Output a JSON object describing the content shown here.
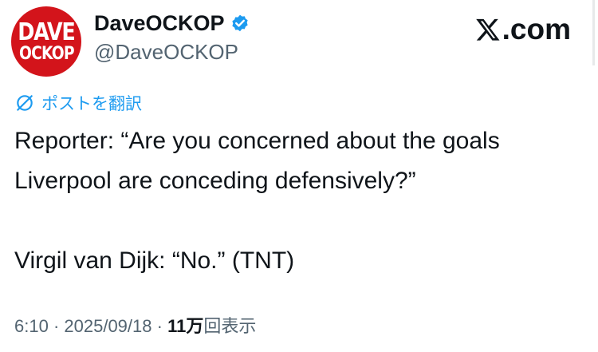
{
  "avatar": {
    "line1": "DAVE",
    "line2": "OCKOP",
    "bg_color": "#d3141b"
  },
  "author": {
    "display_name": "DaveOCKOP",
    "handle": "@DaveOCKOP",
    "verified": true
  },
  "brand": {
    "logo_text": ".com",
    "icon": "x-logo-icon"
  },
  "translate": {
    "label": "ポストを翻訳",
    "icon": "globe-icon",
    "color": "#1d9bf0"
  },
  "tweet": {
    "line1": "Reporter: “Are you concerned about the goals",
    "line2": "Liverpool are conceding defensively?”",
    "line3": "Virgil van Dijk: “No.” (TNT)"
  },
  "meta": {
    "time": "6:10",
    "separator": " · ",
    "date": "2025/09/18",
    "views_count": "11万",
    "views_suffix": "回表示"
  }
}
